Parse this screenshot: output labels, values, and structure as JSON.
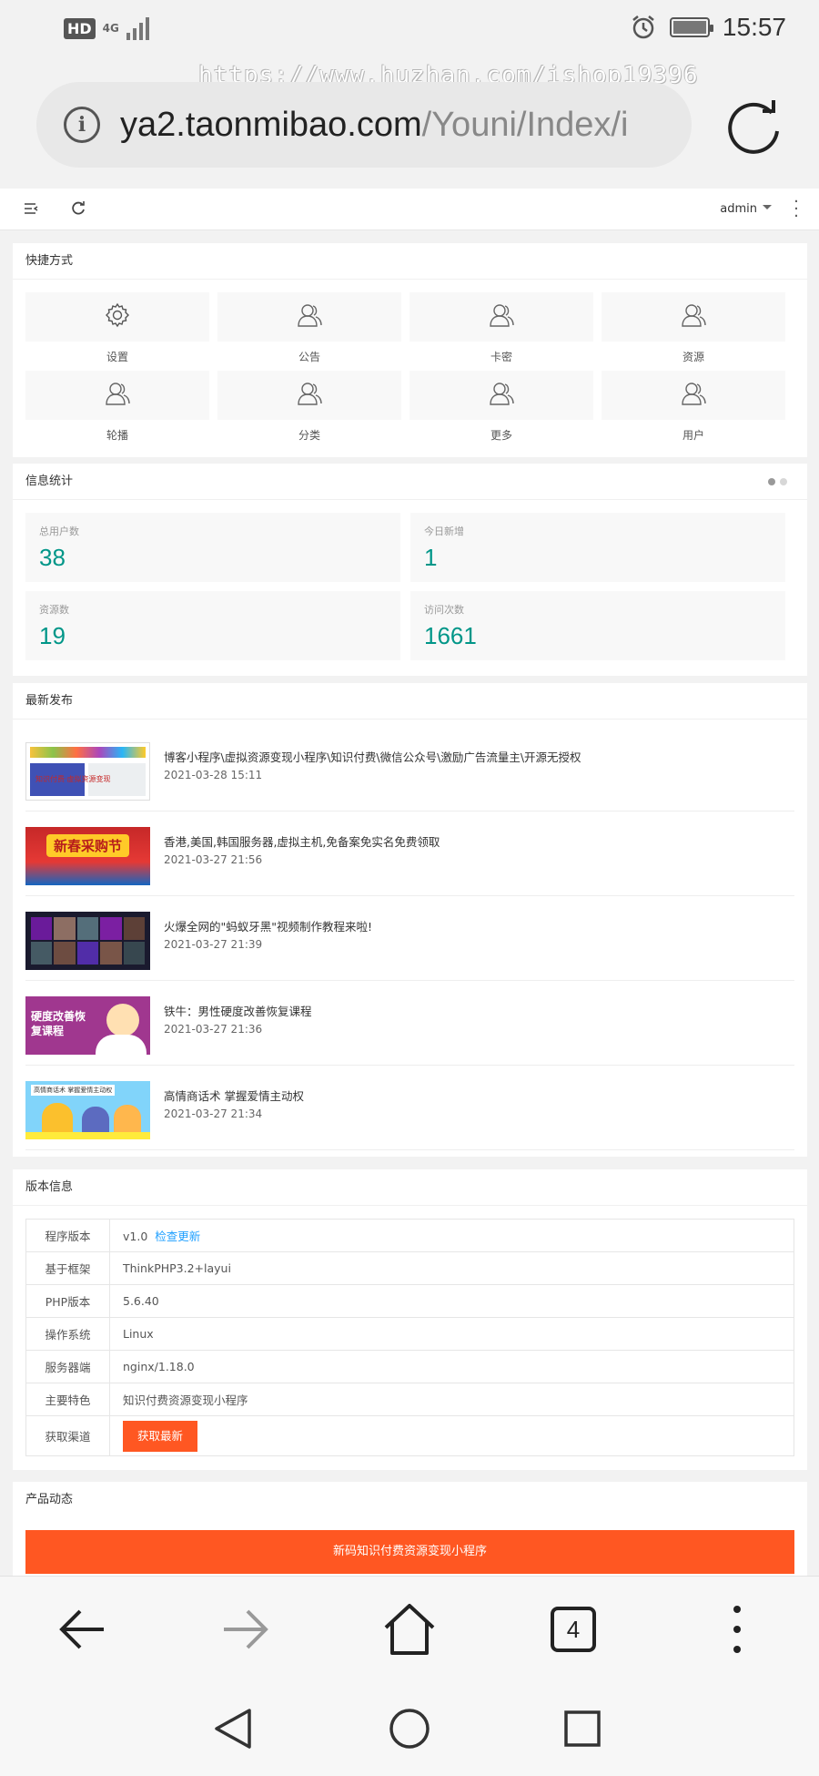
{
  "status_bar": {
    "hd": "HD",
    "network": "4G",
    "time": "15:57"
  },
  "watermark": "https://www.huzhan.com/ishop19396",
  "browser": {
    "url_domain": "ya2.taonmibao.com",
    "url_path": "/Youni/Index/i",
    "tab_count": "4"
  },
  "topnav": {
    "user": "admin"
  },
  "shortcuts": {
    "title": "快捷方式",
    "items": [
      {
        "label": "设置",
        "icon": "gear-icon"
      },
      {
        "label": "公告",
        "icon": "user-icon"
      },
      {
        "label": "卡密",
        "icon": "user-icon"
      },
      {
        "label": "资源",
        "icon": "user-icon"
      },
      {
        "label": "轮播",
        "icon": "user-icon"
      },
      {
        "label": "分类",
        "icon": "user-icon"
      },
      {
        "label": "更多",
        "icon": "user-icon"
      },
      {
        "label": "用户",
        "icon": "user-icon"
      }
    ]
  },
  "stats": {
    "title": "信息统计",
    "items": [
      {
        "label": "总用户数",
        "value": "38"
      },
      {
        "label": "今日新增",
        "value": "1"
      },
      {
        "label": "资源数",
        "value": "19"
      },
      {
        "label": "访问次数",
        "value": "1661"
      }
    ]
  },
  "latest": {
    "title": "最新发布",
    "items": [
      {
        "title": "博客小程序\\虚拟资源变现小程序\\知识付费\\微信公众号\\激励广告流量主\\开源无授权",
        "date": "2021-03-28 15:11",
        "thumb_text": "知识付费·虚拟资源变现"
      },
      {
        "title": "香港,美国,韩国服务器,虚拟主机,免备案免实名免费领取",
        "date": "2021-03-27 21:56",
        "thumb_text": "新春采购节"
      },
      {
        "title": "火爆全网的\"蚂蚁牙黑\"视频制作教程来啦!",
        "date": "2021-03-27 21:39",
        "thumb_text": ""
      },
      {
        "title": "铁牛：男性硬度改善恢复课程",
        "date": "2021-03-27 21:36",
        "thumb_text": "硬度改善恢复课程"
      },
      {
        "title": "高情商话术 掌握爱情主动权",
        "date": "2021-03-27 21:34",
        "thumb_text": "高情商话术 掌握爱情主动权"
      }
    ]
  },
  "version": {
    "title": "版本信息",
    "rows": [
      {
        "key": "程序版本",
        "value": "v1.0",
        "link": "检查更新"
      },
      {
        "key": "基于框架",
        "value": "ThinkPHP3.2+layui"
      },
      {
        "key": "PHP版本",
        "value": "5.6.40"
      },
      {
        "key": "操作系统",
        "value": "Linux"
      },
      {
        "key": "服务器端",
        "value": "nginx/1.18.0"
      },
      {
        "key": "主要特色",
        "value": "知识付费资源变现小程序"
      },
      {
        "key": "获取渠道",
        "button": "获取最新"
      }
    ]
  },
  "product": {
    "title": "产品动态",
    "banner": "新码知识付费资源变现小程序"
  },
  "colors": {
    "accent_green": "#009688",
    "accent_orange": "#ff5722",
    "link_blue": "#1e9fff"
  }
}
